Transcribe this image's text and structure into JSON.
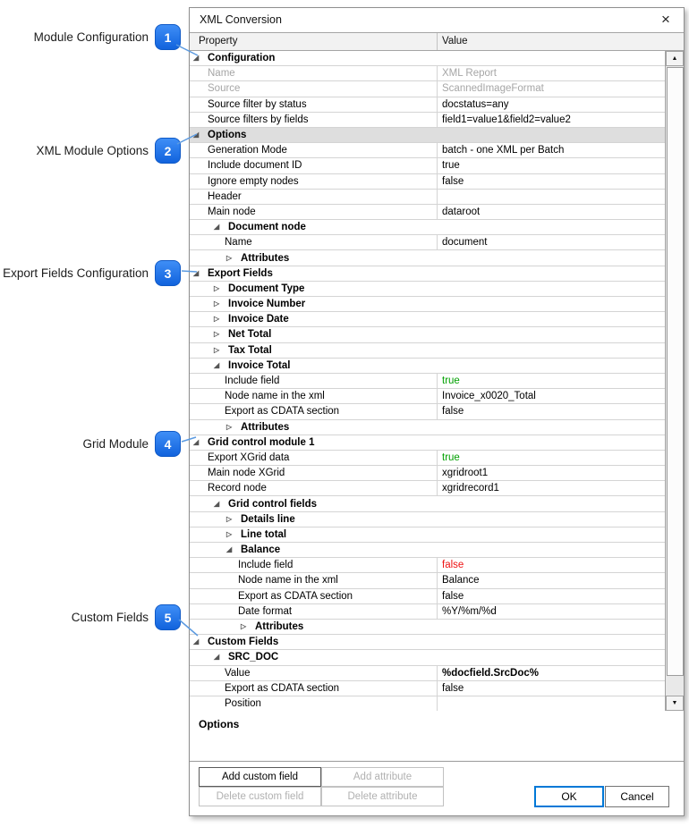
{
  "callouts": [
    {
      "num": "1",
      "label": "Module Configuration"
    },
    {
      "num": "2",
      "label": "XML Module Options"
    },
    {
      "num": "3",
      "label": "Export Fields Configuration"
    },
    {
      "num": "4",
      "label": "Grid Module"
    },
    {
      "num": "5",
      "label": "Custom Fields"
    }
  ],
  "icons": {
    "close": "×",
    "section_expanded": "◢",
    "section_collapsed": "▷",
    "scroll_up": "▲",
    "scroll_down": "▼"
  },
  "colors": {
    "badge_blue": "#1b76f2",
    "connector_blue": "#5b9ae0",
    "value_true_green": "#00a000",
    "value_false_red": "#ee1111",
    "selected_row_bg": "#dedede",
    "ok_focus_border": "#0078d7"
  },
  "dialog": {
    "title": "XML Conversion",
    "grid": {
      "columns": {
        "property": "Property",
        "value": "Value"
      },
      "rows": [
        {
          "kind": "section",
          "level": 0,
          "expand": "open",
          "name": "Configuration"
        },
        {
          "kind": "prop",
          "level": 0,
          "name": "Name",
          "value": "XML Report",
          "disabled": true
        },
        {
          "kind": "prop",
          "level": 0,
          "name": "Source",
          "value": "ScannedImageFormat",
          "disabled": true
        },
        {
          "kind": "prop",
          "level": 0,
          "name": "Source filter by status",
          "value": "docstatus=any"
        },
        {
          "kind": "prop",
          "level": 0,
          "name": "Source filters by fields",
          "value": "field1=value1&field2=value2"
        },
        {
          "kind": "section",
          "level": 0,
          "expand": "open",
          "name": "Options",
          "selected": true
        },
        {
          "kind": "prop",
          "level": 0,
          "name": "Generation Mode",
          "value": "batch - one XML per Batch"
        },
        {
          "kind": "prop",
          "level": 0,
          "name": "Include document ID",
          "value": "true"
        },
        {
          "kind": "prop",
          "level": 0,
          "name": "Ignore empty nodes",
          "value": "false"
        },
        {
          "kind": "prop",
          "level": 0,
          "name": "Header",
          "value": ""
        },
        {
          "kind": "prop",
          "level": 0,
          "name": "Main node",
          "value": "dataroot"
        },
        {
          "kind": "section",
          "level": 1,
          "expand": "open",
          "name": "Document node"
        },
        {
          "kind": "prop",
          "level": 1,
          "name": "Name",
          "value": "document"
        },
        {
          "kind": "section",
          "level": 2,
          "expand": "closed",
          "name": "Attributes"
        },
        {
          "kind": "section",
          "level": 0,
          "expand": "open",
          "name": "Export Fields"
        },
        {
          "kind": "section",
          "level": 1,
          "expand": "closed",
          "name": "Document Type"
        },
        {
          "kind": "section",
          "level": 1,
          "expand": "closed",
          "name": "Invoice Number"
        },
        {
          "kind": "section",
          "level": 1,
          "expand": "closed",
          "name": "Invoice Date"
        },
        {
          "kind": "section",
          "level": 1,
          "expand": "closed",
          "name": "Net Total"
        },
        {
          "kind": "section",
          "level": 1,
          "expand": "closed",
          "name": "Tax Total"
        },
        {
          "kind": "section",
          "level": 1,
          "expand": "open",
          "name": "Invoice Total"
        },
        {
          "kind": "prop",
          "level": 1,
          "name": "Include field",
          "value": "true",
          "value_style": "green"
        },
        {
          "kind": "prop",
          "level": 1,
          "name": "Node name in the xml",
          "value": "Invoice_x0020_Total"
        },
        {
          "kind": "prop",
          "level": 1,
          "name": "Export as CDATA section",
          "value": "false"
        },
        {
          "kind": "section",
          "level": 2,
          "expand": "closed",
          "name": "Attributes"
        },
        {
          "kind": "section",
          "level": 0,
          "expand": "open",
          "name": "Grid control module 1"
        },
        {
          "kind": "prop",
          "level": 0,
          "name": "Export XGrid data",
          "value": "true",
          "value_style": "green"
        },
        {
          "kind": "prop",
          "level": 0,
          "name": "Main node XGrid",
          "value": "xgridroot1"
        },
        {
          "kind": "prop",
          "level": 0,
          "name": "Record node",
          "value": "xgridrecord1"
        },
        {
          "kind": "section",
          "level": 1,
          "expand": "open",
          "name": "Grid control fields"
        },
        {
          "kind": "section",
          "level": 2,
          "expand": "closed",
          "name": "Details line"
        },
        {
          "kind": "section",
          "level": 2,
          "expand": "closed",
          "name": "Line total"
        },
        {
          "kind": "section",
          "level": 2,
          "expand": "open",
          "name": "Balance"
        },
        {
          "kind": "prop",
          "level": 2,
          "name": "Include field",
          "value": "false",
          "value_style": "red"
        },
        {
          "kind": "prop",
          "level": 2,
          "name": "Node name in the xml",
          "value": "Balance"
        },
        {
          "kind": "prop",
          "level": 2,
          "name": "Export as CDATA section",
          "value": "false"
        },
        {
          "kind": "prop",
          "level": 2,
          "name": "Date format",
          "value": "%Y/%m/%d"
        },
        {
          "kind": "section",
          "level": 3,
          "expand": "closed",
          "name": "Attributes"
        },
        {
          "kind": "section",
          "level": 0,
          "expand": "open",
          "name": "Custom Fields"
        },
        {
          "kind": "section",
          "level": 1,
          "expand": "open",
          "name": "SRC_DOC"
        },
        {
          "kind": "prop",
          "level": 1,
          "name": "Value",
          "value": "%docfield.SrcDoc%",
          "value_style": "bold"
        },
        {
          "kind": "prop",
          "level": 1,
          "name": "Export as CDATA section",
          "value": "false"
        },
        {
          "kind": "prop",
          "level": 1,
          "name": "Position",
          "value": ""
        }
      ]
    },
    "description_panel": {
      "title": "Options"
    },
    "footer": {
      "add_custom_field": "Add custom field",
      "add_attribute": "Add attribute",
      "delete_custom_field": "Delete custom field",
      "delete_attribute": "Delete attribute",
      "ok": "OK",
      "cancel": "Cancel"
    }
  }
}
